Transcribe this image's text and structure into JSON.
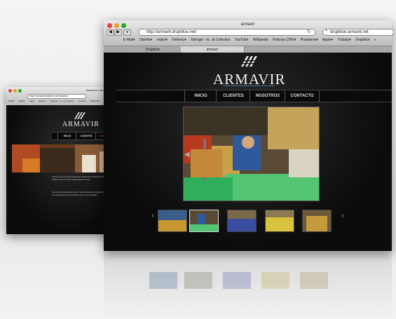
{
  "back_window": {
    "title": "Nosotros | armavir",
    "address": "http://armavir.drupblue.net/nosotros",
    "bookmarks": [
      "E-Mail",
      "Diseño",
      "viajes",
      "Delivery",
      "Taringa! - In...la Colectiva",
      "YouTube",
      "Wikipedia"
    ],
    "brand": "ARMAVIR",
    "nav": [
      "INICIO",
      "CLIENTES",
      "NOSOTROS"
    ],
    "para1": "Somos una empresa argentina dedicada a la fabricación de productos textiles que en 1947 funda Hipolito Pesa...",
    "para2": "Nos dedicamos desde hace más de 60 años al desarrollo, fabricación y comercialización de artículos de primera calidad..."
  },
  "front_window": {
    "title": "armavir",
    "address": "http://armavir.drupblue.net/",
    "search": "drupblue.armavir.net",
    "bookmarks": [
      "E-Mail▾",
      "Diseño▾",
      "viajes▾",
      "Delivery▾",
      "Taringa! - In...la Colectiva",
      "YouTube",
      "Wikipedia",
      "Noticias (256)▾",
      "Populares▾",
      "Apple▾",
      "Trabajo▾",
      "Drupblue",
      "»"
    ],
    "tabs": [
      "Drupblue",
      "armavir"
    ],
    "brand": "ARMAVIR",
    "nav": [
      "INICIO",
      "CLIENTES",
      "NOSOTROS",
      "CONTACTO"
    ],
    "thumb_count_label": "5"
  },
  "colors": {
    "accent": "#5b6ea8",
    "nav_bg": "#0a0a0a"
  }
}
